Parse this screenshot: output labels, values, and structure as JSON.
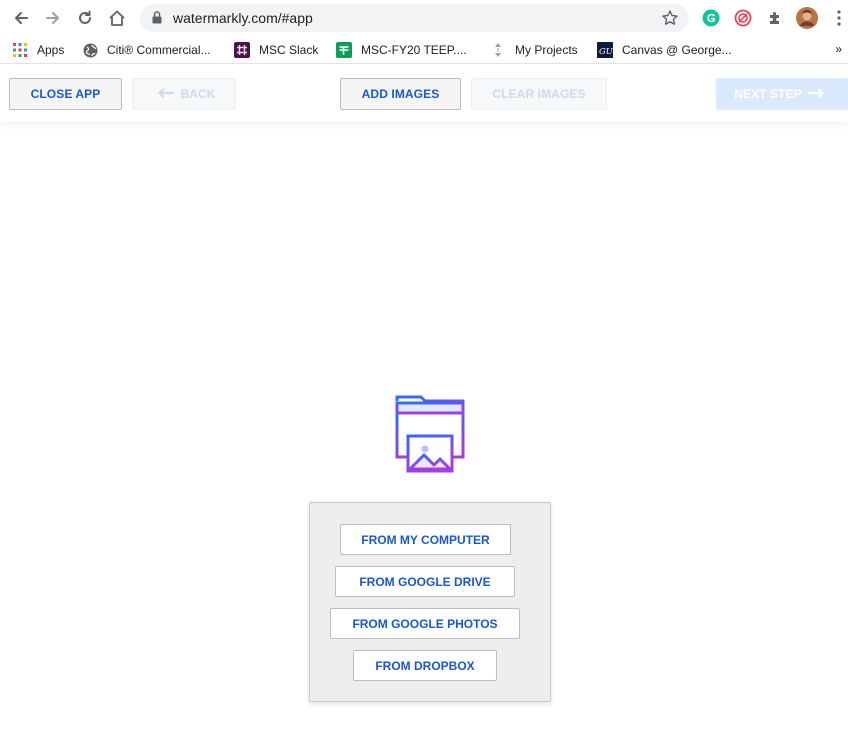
{
  "browser": {
    "url": "watermarkly.com/#app",
    "icons": {
      "back": "arrow-left-icon",
      "forward": "arrow-right-icon",
      "reload": "reload-icon",
      "home": "home-icon",
      "lock": "lock-icon",
      "bookmark_star": "star-icon",
      "grammarly": "grammarly-icon",
      "extension_red": "swirl-extension-icon",
      "extensions": "puzzle-icon",
      "profile": "avatar",
      "menu": "kebab-menu-icon"
    },
    "colors": {
      "grammarly": "#15c39a",
      "extension_red": "#e8455a"
    }
  },
  "bookmarks": {
    "items": [
      {
        "label": "Apps",
        "icon": "apps-grid-icon"
      },
      {
        "label": "Citi® Commercial...",
        "icon": "globe-icon"
      },
      {
        "label": "MSC Slack",
        "icon": "slack-icon"
      },
      {
        "label": "MSC-FY20 TEEP....",
        "icon": "sheets-icon"
      },
      {
        "label": "My Projects",
        "icon": "projects-icon"
      },
      {
        "label": "Canvas @ George...",
        "icon": "gu-icon"
      }
    ],
    "more": "»"
  },
  "header": {
    "close_label": "CLOSE APP",
    "back_label": "BACK",
    "add_images_label": "ADD IMAGES",
    "clear_images_label": "CLEAR IMAGES",
    "next_step_label": "NEXT STEP"
  },
  "upload": {
    "icon": "image-folder-icon",
    "sources": [
      "FROM MY COMPUTER",
      "FROM GOOGLE DRIVE",
      "FROM GOOGLE PHOTOS",
      "FROM DROPBOX"
    ]
  },
  "colors": {
    "accent": "#1a56d6",
    "icon_gradient_start": "#2f6bff",
    "icon_gradient_end": "#a63de0",
    "next_button_bg": "#dbe9fd"
  }
}
